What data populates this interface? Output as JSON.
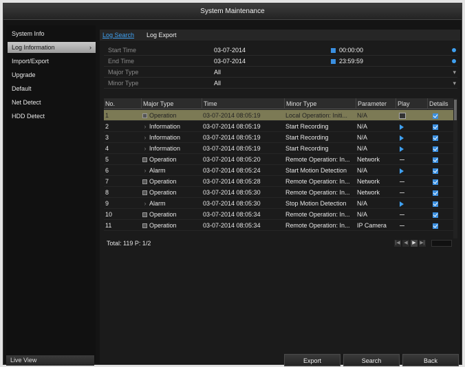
{
  "window": {
    "title": "System Maintenance"
  },
  "sidebar": {
    "items": [
      {
        "label": "System Info"
      },
      {
        "label": "Log Information",
        "chevron": "›"
      },
      {
        "label": "Import/Export"
      },
      {
        "label": "Upgrade"
      },
      {
        "label": "Default"
      },
      {
        "label": "Net Detect"
      },
      {
        "label": "HDD Detect"
      }
    ],
    "live_view": "Live View"
  },
  "tabs": {
    "log_search": "Log Search",
    "log_export": "Log Export"
  },
  "filters": {
    "start_time": {
      "label": "Start Time",
      "date": "03-07-2014",
      "time": "00:00:00"
    },
    "end_time": {
      "label": "End Time",
      "date": "03-07-2014",
      "time": "23:59:59"
    },
    "major_type": {
      "label": "Major Type",
      "value": "All"
    },
    "minor_type": {
      "label": "Minor Type",
      "value": "All"
    }
  },
  "table": {
    "headers": [
      "No.",
      "Major Type",
      "Time",
      "Minor Type",
      "Parameter",
      "Play",
      "Details"
    ],
    "rows": [
      {
        "no": "1",
        "major": "Operation",
        "major_icon": "operation-icon",
        "time": "03-07-2014 08:05:19",
        "minor": "Local Operation: Initi...",
        "param": "N/A",
        "play": "box",
        "selected": true
      },
      {
        "no": "2",
        "major": "Information",
        "major_icon": "information-icon",
        "time": "03-07-2014 08:05:19",
        "minor": "Start Recording",
        "param": "N/A",
        "play": "play"
      },
      {
        "no": "3",
        "major": "Information",
        "major_icon": "information-icon",
        "time": "03-07-2014 08:05:19",
        "minor": "Start Recording",
        "param": "N/A",
        "play": "play"
      },
      {
        "no": "4",
        "major": "Information",
        "major_icon": "information-icon",
        "time": "03-07-2014 08:05:19",
        "minor": "Start Recording",
        "param": "N/A",
        "play": "play"
      },
      {
        "no": "5",
        "major": "Operation",
        "major_icon": "operation-icon",
        "time": "03-07-2014 08:05:20",
        "minor": "Remote Operation: In...",
        "param": "Network",
        "play": "dash"
      },
      {
        "no": "6",
        "major": "Alarm",
        "major_icon": "alarm-icon",
        "time": "03-07-2014 08:05:24",
        "minor": "Start Motion Detection",
        "param": "N/A",
        "play": "play"
      },
      {
        "no": "7",
        "major": "Operation",
        "major_icon": "operation-icon",
        "time": "03-07-2014 08:05:28",
        "minor": "Remote Operation: In...",
        "param": "Network",
        "play": "dash"
      },
      {
        "no": "8",
        "major": "Operation",
        "major_icon": "operation-icon",
        "time": "03-07-2014 08:05:30",
        "minor": "Remote Operation: In...",
        "param": "Network",
        "play": "dash"
      },
      {
        "no": "9",
        "major": "Alarm",
        "major_icon": "alarm-icon",
        "time": "03-07-2014 08:05:30",
        "minor": "Stop Motion Detection",
        "param": "N/A",
        "play": "play"
      },
      {
        "no": "10",
        "major": "Operation",
        "major_icon": "operation-icon",
        "time": "03-07-2014 08:05:34",
        "minor": "Remote Operation: In...",
        "param": "N/A",
        "play": "dash"
      },
      {
        "no": "11",
        "major": "Operation",
        "major_icon": "operation-icon",
        "time": "03-07-2014 08:05:34",
        "minor": "Remote Operation: In...",
        "param": "IP Camera",
        "play": "dash"
      }
    ]
  },
  "footer": {
    "total": "Total: 119  P: 1/2"
  },
  "buttons": {
    "export": "Export",
    "search": "Search",
    "back": "Back"
  },
  "colors": {
    "accent": "#3fa0f0",
    "selected_row": "#7c7a55",
    "background": "#141414"
  }
}
